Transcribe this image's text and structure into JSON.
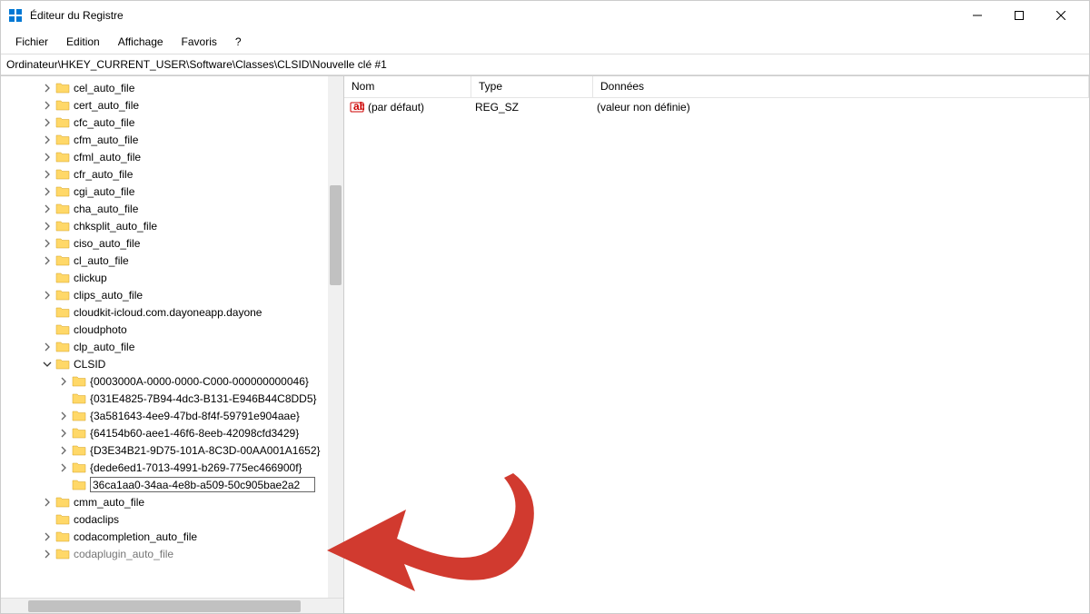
{
  "window": {
    "title": "Éditeur du Registre"
  },
  "menubar": {
    "items": [
      "Fichier",
      "Edition",
      "Affichage",
      "Favoris",
      "?"
    ]
  },
  "addressbar": {
    "path": "Ordinateur\\HKEY_CURRENT_USER\\Software\\Classes\\CLSID\\Nouvelle clé #1"
  },
  "tree": {
    "items": [
      {
        "label": "cel_auto_file",
        "expandable": true,
        "indent": 0
      },
      {
        "label": "cert_auto_file",
        "expandable": true,
        "indent": 0
      },
      {
        "label": "cfc_auto_file",
        "expandable": true,
        "indent": 0
      },
      {
        "label": "cfm_auto_file",
        "expandable": true,
        "indent": 0
      },
      {
        "label": "cfml_auto_file",
        "expandable": true,
        "indent": 0
      },
      {
        "label": "cfr_auto_file",
        "expandable": true,
        "indent": 0
      },
      {
        "label": "cgi_auto_file",
        "expandable": true,
        "indent": 0
      },
      {
        "label": "cha_auto_file",
        "expandable": true,
        "indent": 0
      },
      {
        "label": "chksplit_auto_file",
        "expandable": true,
        "indent": 0
      },
      {
        "label": "ciso_auto_file",
        "expandable": true,
        "indent": 0
      },
      {
        "label": "cl_auto_file",
        "expandable": true,
        "indent": 0
      },
      {
        "label": "clickup",
        "expandable": false,
        "indent": 0
      },
      {
        "label": "clips_auto_file",
        "expandable": true,
        "indent": 0
      },
      {
        "label": "cloudkit-icloud.com.dayoneapp.dayone",
        "expandable": false,
        "indent": 0
      },
      {
        "label": "cloudphoto",
        "expandable": false,
        "indent": 0
      },
      {
        "label": "clp_auto_file",
        "expandable": true,
        "indent": 0
      },
      {
        "label": "CLSID",
        "expandable": true,
        "expanded": true,
        "indent": 0
      },
      {
        "label": "{0003000A-0000-0000-C000-000000000046}",
        "expandable": true,
        "indent": 1,
        "truncated": true
      },
      {
        "label": "{031E4825-7B94-4dc3-B131-E946B44C8DD5}",
        "expandable": false,
        "indent": 1,
        "truncated": true
      },
      {
        "label": "{3a581643-4ee9-47bd-8f4f-59791e904aae}",
        "expandable": true,
        "indent": 1,
        "truncated": true
      },
      {
        "label": "{64154b60-aee1-46f6-8eeb-42098cfd3429}",
        "expandable": true,
        "indent": 1,
        "truncated": true
      },
      {
        "label": "{D3E34B21-9D75-101A-8C3D-00AA001A1652}",
        "expandable": true,
        "indent": 1,
        "truncated": true
      },
      {
        "label": "{dede6ed1-7013-4991-b269-775ec466900f}",
        "expandable": true,
        "indent": 1,
        "truncated": true
      },
      {
        "label": "36ca1aa0-34aa-4e8b-a509-50c905bae2a2",
        "expandable": false,
        "indent": 1,
        "editing": true
      },
      {
        "label": "cmm_auto_file",
        "expandable": true,
        "indent": 0
      },
      {
        "label": "codaclips",
        "expandable": false,
        "indent": 0
      },
      {
        "label": "codacompletion_auto_file",
        "expandable": true,
        "indent": 0
      },
      {
        "label": "codaplugin_auto_file",
        "expandable": true,
        "indent": 0,
        "faded": true
      }
    ]
  },
  "list": {
    "columns": {
      "name": "Nom",
      "type": "Type",
      "data": "Données"
    },
    "rows": [
      {
        "name": "(par défaut)",
        "type": "REG_SZ",
        "data": "(valeur non définie)"
      }
    ]
  }
}
